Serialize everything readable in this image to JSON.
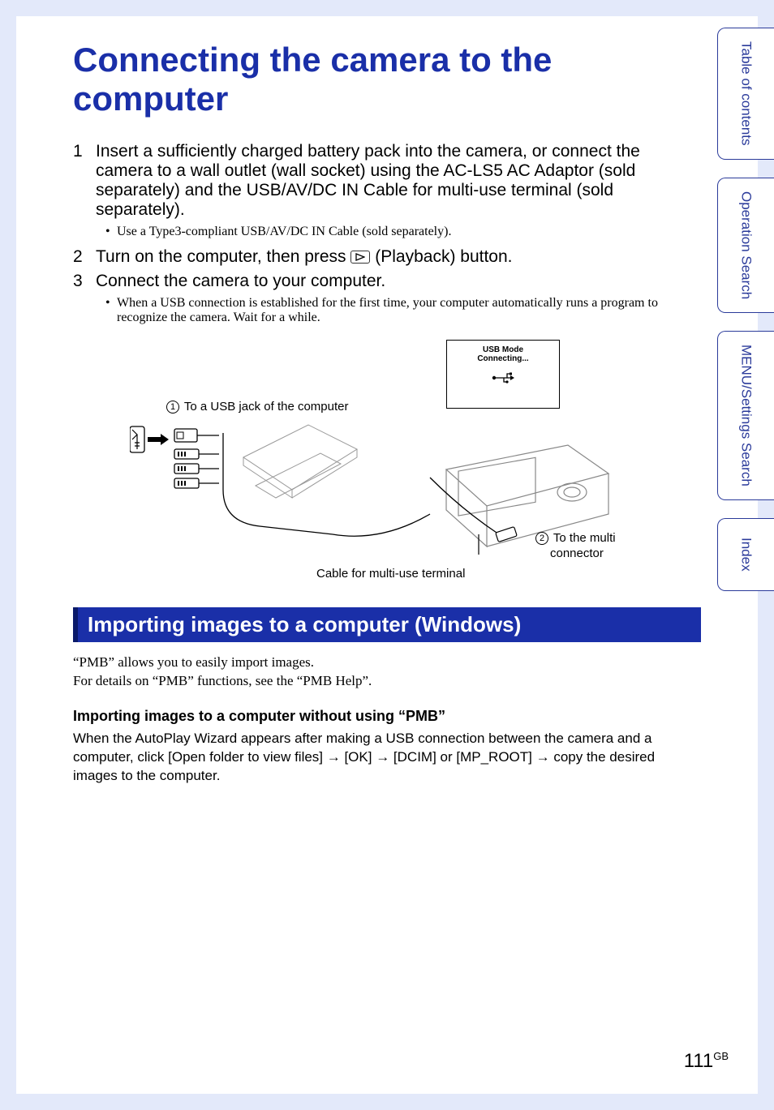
{
  "title": "Connecting the camera to the computer",
  "steps": {
    "s1": {
      "num": "1",
      "text": "Insert a sufficiently charged battery pack into the camera, or connect the camera to a wall outlet (wall socket) using the AC-LS5 AC Adaptor (sold separately) and the USB/AV/DC IN Cable for multi-use terminal (sold separately)."
    },
    "s1_bullet": "Use a Type3-compliant USB/AV/DC IN Cable (sold separately).",
    "s2": {
      "num": "2",
      "text_pre": "Turn on the computer, then press ",
      "text_post": " (Playback) button."
    },
    "s3": {
      "num": "3",
      "text": "Connect the camera to your computer."
    },
    "s3_bullet": "When a USB connection is established for the first time, your computer automatically runs a program to recognize the camera. Wait for a while."
  },
  "diagram": {
    "screen_line1": "USB Mode",
    "screen_line2": "Connecting...",
    "callout1_num": "1",
    "callout1_text": " To a USB jack of the computer",
    "callout2_num": "2",
    "callout2_text_l1": " To the multi",
    "callout2_text_l2": "connector",
    "cable_label": "Cable for multi-use terminal"
  },
  "section_bar": "Importing images to a computer (Windows)",
  "body1": "“PMB” allows you to easily import images.",
  "body2": "For details on “PMB” functions, see the “PMB Help”.",
  "sub_heading": "Importing images to a computer without using “PMB”",
  "body3": "When the AutoPlay Wizard appears after making a USB connection between the camera and a computer, click [Open folder to view files] → [OK] → [DCIM] or [MP_ROOT] → copy the desired images to the computer.",
  "tabs": {
    "t1": "Table of contents",
    "t2": "Operation Search",
    "t3": "MENU/Settings Search",
    "t4": "Index"
  },
  "page_number": "111",
  "page_suffix": "GB"
}
